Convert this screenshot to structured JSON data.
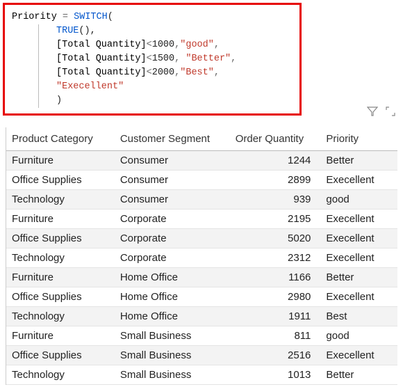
{
  "formula": {
    "measure_name": "Priority",
    "equals": " = ",
    "func": "SWITCH",
    "open": "(",
    "line2_func": "TRUE",
    "line2_rest": "(),",
    "cond_measure": "[Total Quantity]",
    "lt": "<",
    "cond1_num": "1000",
    "cond1_str": "\"good\"",
    "cond2_num": "1500",
    "cond2_str": "\"Better\"",
    "cond3_num": "2000",
    "cond3_str": "\"Best\"",
    "comma": ",",
    "comma_sp": ", ",
    "else_str": "\"Execellent\"",
    "close": ")"
  },
  "toolbar": {
    "filter_icon": "filter-icon",
    "expand_icon": "expand-icon"
  },
  "table": {
    "headers": {
      "c1": "Product Category",
      "c2": "Customer Segment",
      "c3": "Order Quantity",
      "c4": "Priority"
    },
    "rows": [
      {
        "cat": "Furniture",
        "seg": "Consumer",
        "qty": "1244",
        "pri": "Better"
      },
      {
        "cat": "Office Supplies",
        "seg": "Consumer",
        "qty": "2899",
        "pri": "Execellent"
      },
      {
        "cat": "Technology",
        "seg": "Consumer",
        "qty": "939",
        "pri": "good"
      },
      {
        "cat": "Furniture",
        "seg": "Corporate",
        "qty": "2195",
        "pri": "Execellent"
      },
      {
        "cat": "Office Supplies",
        "seg": "Corporate",
        "qty": "5020",
        "pri": "Execellent"
      },
      {
        "cat": "Technology",
        "seg": "Corporate",
        "qty": "2312",
        "pri": "Execellent"
      },
      {
        "cat": "Furniture",
        "seg": "Home Office",
        "qty": "1166",
        "pri": "Better"
      },
      {
        "cat": "Office Supplies",
        "seg": "Home Office",
        "qty": "2980",
        "pri": "Execellent"
      },
      {
        "cat": "Technology",
        "seg": "Home Office",
        "qty": "1911",
        "pri": "Best"
      },
      {
        "cat": "Furniture",
        "seg": "Small Business",
        "qty": "811",
        "pri": "good"
      },
      {
        "cat": "Office Supplies",
        "seg": "Small Business",
        "qty": "2516",
        "pri": "Execellent"
      },
      {
        "cat": "Technology",
        "seg": "Small Business",
        "qty": "1013",
        "pri": "Better"
      }
    ]
  }
}
